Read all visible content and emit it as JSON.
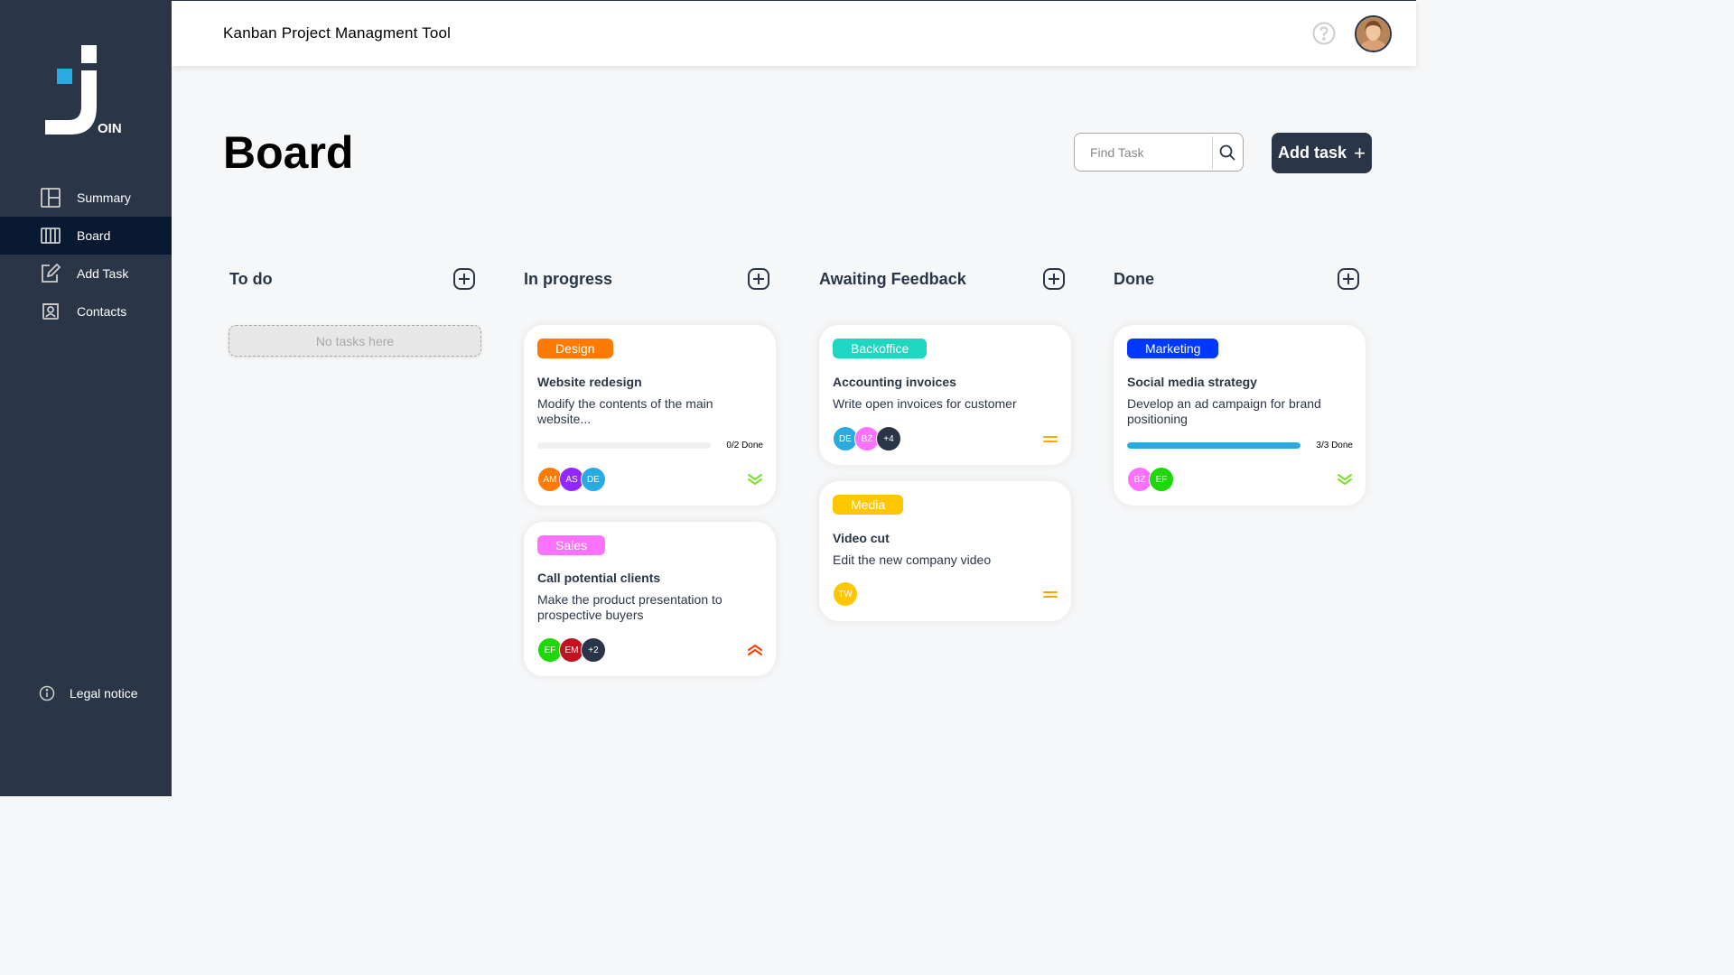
{
  "app": {
    "title": "Kanban Project Managment Tool"
  },
  "logo": {
    "text": "OIN"
  },
  "sidebar": {
    "items": [
      {
        "label": "Summary",
        "icon": "summary-icon",
        "active": false
      },
      {
        "label": "Board",
        "icon": "board-icon",
        "active": true
      },
      {
        "label": "Add Task",
        "icon": "add-task-icon",
        "active": false
      },
      {
        "label": "Contacts",
        "icon": "contacts-icon",
        "active": false
      }
    ],
    "legal": "Legal notice"
  },
  "board": {
    "title": "Board",
    "search_placeholder": "Find Task",
    "add_task_label": "Add task",
    "add_task_plus": "+"
  },
  "columns": [
    {
      "title": "To do",
      "empty_text": "No tasks here"
    },
    {
      "title": "In progress"
    },
    {
      "title": "Awaiting Feedback"
    },
    {
      "title": "Done"
    }
  ],
  "cards": [
    {
      "category": "Design",
      "category_color": "#ff7a00",
      "title": "Website redesign",
      "description": "Modify the contents of the main website...",
      "progress": 0,
      "progress_text": "0/2 Done",
      "assignees": [
        {
          "initials": "AM",
          "color": "#ff7a00"
        },
        {
          "initials": "AS",
          "color": "#9327ff"
        },
        {
          "initials": "DE",
          "color": "#29abe2"
        }
      ],
      "priority": "low",
      "priority_icon": "priority-low-icon"
    },
    {
      "category": "Sales",
      "category_color": "#fc71ff",
      "title": "Call potential clients",
      "description": "Make the product presentation to prospective buyers",
      "assignees": [
        {
          "initials": "EF",
          "color": "#1fd70a"
        },
        {
          "initials": "EM",
          "color": "#c1121f"
        },
        {
          "initials": "+2",
          "color": "#2a3647"
        }
      ],
      "priority": "urgent",
      "priority_icon": "priority-urgent-icon"
    },
    {
      "category": "Backoffice",
      "category_color": "#1fd7c1",
      "title": "Accounting invoices",
      "description": "Write open invoices for customer",
      "assignees": [
        {
          "initials": "DE",
          "color": "#29abe2"
        },
        {
          "initials": "BZ",
          "color": "#fc71ff"
        },
        {
          "initials": "+4",
          "color": "#2a3647"
        }
      ],
      "priority": "medium",
      "priority_icon": "priority-medium-icon"
    },
    {
      "category": "Media",
      "category_color": "#ffc701",
      "title": "Video cut",
      "description": "Edit the new company video",
      "assignees": [
        {
          "initials": "TW",
          "color": "#ffc701"
        }
      ],
      "priority": "medium",
      "priority_icon": "priority-medium-icon"
    },
    {
      "category": "Marketing",
      "category_color": "#0038ff",
      "title": "Social media strategy",
      "description": "Develop an ad campaign for brand positioning",
      "progress": 1,
      "progress_text": "3/3 Done",
      "assignees": [
        {
          "initials": "BZ",
          "color": "#fc71ff"
        },
        {
          "initials": "EF",
          "color": "#1fd70a"
        }
      ],
      "priority": "low",
      "priority_icon": "priority-low-icon"
    }
  ]
}
